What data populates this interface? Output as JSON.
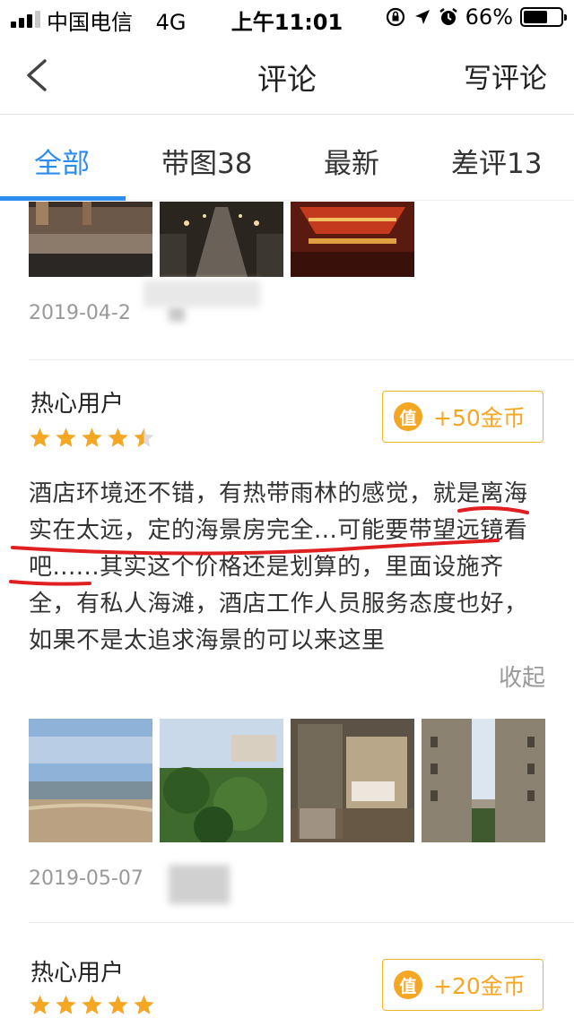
{
  "status_bar": {
    "carrier": "中国电信",
    "network": "4G",
    "time": "上午11:01",
    "battery_percent": "66%",
    "battery_level": 0.66
  },
  "nav": {
    "title": "评论",
    "action": "写评论"
  },
  "tabs": [
    {
      "label": "全部",
      "active": true
    },
    {
      "label": "带图38",
      "active": false
    },
    {
      "label": "最新",
      "active": false
    },
    {
      "label": "差评13",
      "active": false
    }
  ],
  "reviews": [
    {
      "date": "2019-04-2"
    },
    {
      "username": "热心用户",
      "rating": 4.5,
      "coin_icon": "值",
      "coin_reward": "+50金币",
      "text": "酒店环境还不错，有热带雨林的感觉，就是离海实在太远，定的海景房完全...可能要带望远镜看吧......其实这个价格还是划算的，里面设施齐全，有私人海滩，酒店工作人员服务态度也好，如果不是太追求海景的可以来这里",
      "collapse_label": "收起",
      "date": "2019-05-07"
    },
    {
      "username": "热心用户",
      "rating": 5,
      "coin_icon": "值",
      "coin_reward": "+20金币"
    }
  ],
  "colors": {
    "accent": "#2d8cf0",
    "star": "#f5a623",
    "coin": "#f5a623",
    "annotation": "#e02020"
  }
}
